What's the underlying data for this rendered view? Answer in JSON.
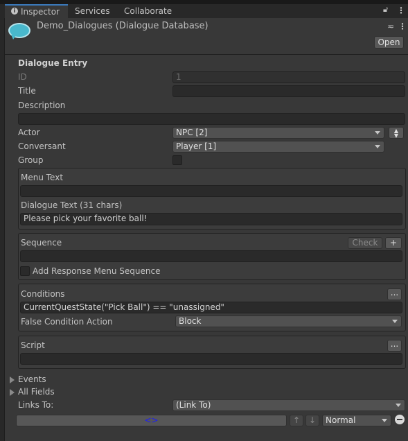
{
  "tabs": [
    {
      "label": "Inspector",
      "icon": "info-icon",
      "active": true
    },
    {
      "label": "Services"
    },
    {
      "label": "Collaborate"
    }
  ],
  "header": {
    "title": "Demo_Dialogues (Dialogue Database)",
    "icon": "speech-bubble-icon",
    "open_label": "Open"
  },
  "section_title": "Dialogue Entry",
  "fields": {
    "id_label": "ID",
    "id_value": "1",
    "title_label": "Title",
    "title_value": "",
    "description_label": "Description",
    "description_value": "",
    "actor_label": "Actor",
    "actor_value": "NPC [2]",
    "conversant_label": "Conversant",
    "conversant_value": "Player [1]",
    "group_label": "Group",
    "group_checked": false
  },
  "text_box": {
    "menu_label": "Menu Text",
    "menu_value": "",
    "dialogue_label": "Dialogue Text (31 chars)",
    "dialogue_value": "Please pick your favorite ball!"
  },
  "sequence_box": {
    "label": "Sequence",
    "check_label": "Check",
    "plus_label": "+",
    "value": "",
    "add_response_label": "Add Response Menu Sequence",
    "add_response_checked": false
  },
  "conditions_box": {
    "label": "Conditions",
    "more_label": "...",
    "value": "CurrentQuestState(\"Pick Ball\") == \"unassigned\"",
    "false_action_label": "False Condition Action",
    "false_action_value": "Block"
  },
  "script_box": {
    "label": "Script",
    "more_label": "...",
    "value": ""
  },
  "foldouts": {
    "events": "Events",
    "all_fields": "All Fields"
  },
  "links": {
    "label": "Links To:",
    "value": "(Link To)",
    "link_text": "<>",
    "link_color": "#1a1aff",
    "priority": "Normal"
  }
}
